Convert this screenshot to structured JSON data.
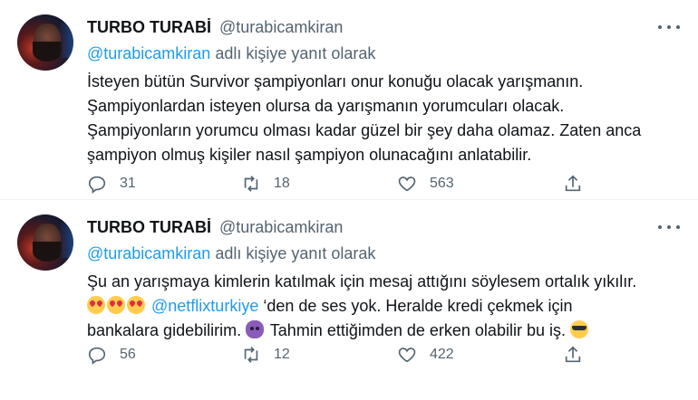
{
  "tweets": [
    {
      "name": "TURBO TURABİ",
      "handle": "@turabicamkiran",
      "reply_handle": "@turabicamkiran",
      "reply_suffix": "adlı kişiye yanıt olarak",
      "lines": [
        "İsteyen bütün Survivor şampiyonları onur konuğu olacak yarışmanın.",
        "Şampiyonlardan isteyen olursa da yarışmanın yorumcuları olacak.",
        "Şampiyonların yorumcu olması kadar güzel bir şey daha olamaz. Zaten anca",
        "şampiyon olmuş kişiler nasıl şampiyon olunacağını anlatabilir."
      ],
      "replies": "31",
      "retweets": "18",
      "likes": "563"
    },
    {
      "name": "TURBO TURABİ",
      "handle": "@turabicamkiran",
      "reply_handle": "@turabicamkiran",
      "reply_suffix": "adlı kişiye yanıt olarak",
      "line1": "Şu an yarışmaya kimlerin katılmak için mesaj attığını söylesem ortalık yıkılır.",
      "mention": "@netflixturkiye",
      "line2_rest": "‘den de ses yok. Heralde kredi çekmek için",
      "line3": "bankalara gidebilirim.",
      "line3_rest": "Tahmin ettiğimden de erken olabilir bu iş.",
      "emojis": [
        "smiling-face-with-heart-eyes",
        "smiling-face-with-heart-eyes",
        "smiling-face-with-heart-eyes",
        "smiling-face-with-horns",
        "smiling-face-with-sunglasses"
      ],
      "replies": "56",
      "retweets": "12",
      "likes": "422"
    }
  ],
  "icons": {
    "reply": "reply-icon",
    "retweet": "retweet-icon",
    "like": "like-icon",
    "share": "share-icon",
    "more": "more-icon"
  },
  "colors": {
    "link": "#1d9bf0",
    "secondary_text": "#536471",
    "primary_text": "#0f1419"
  }
}
